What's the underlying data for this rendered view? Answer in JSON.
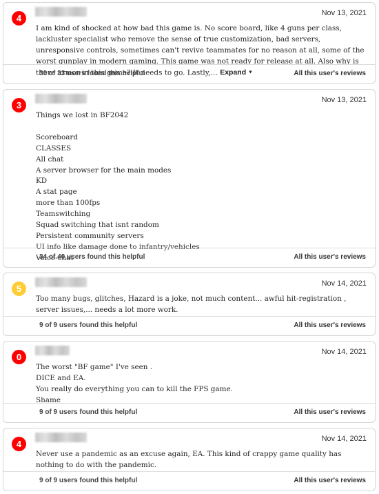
{
  "reviews": [
    {
      "score": "4",
      "score_color": "#ff0000",
      "date": "Nov 13, 2021",
      "text": "I am kind of shocked at how bad this game is. No score board, like 4 guns per class, lackluster specialist who remove the sense of true customization, bad servers, unresponsive controls, sometimes can't revive teammates for no reason at all, some of the worst gunplay in modern gaming. This game was not ready for release at all. Also why is there armor in this game? It needs to go. Lastly,…",
      "expand_label": "Expand",
      "helpful": "30 of 33 users found this helpful",
      "all_reviews_label": "All this user's reviews"
    },
    {
      "score": "3",
      "score_color": "#ff0000",
      "date": "Nov 13, 2021",
      "text": "Things we lost in BF2042\n\nScoreboard\nCLASSES\nAll chat\nA server browser for the main modes\nKD\nA stat page\nmore than 100fps\nTeamswitching\nSquad switching that isnt random\nPersistent community servers\nUI info like damage done to infantry/vehicles\nVoice-chat",
      "helpful": "34 of 40 users found this helpful",
      "all_reviews_label": "All this user's reviews"
    },
    {
      "score": "5",
      "score_color": "#ffcc33",
      "date": "Nov 14, 2021",
      "text": "Too many bugs, glitches, Hazard is a joke, not much content... awful hit-registration , server issues,... needs a lot more work.",
      "helpful": "9 of 9 users found this helpful",
      "all_reviews_label": "All this user's reviews"
    },
    {
      "score": "0",
      "score_color": "#ff0000",
      "date": "Nov 14, 2021",
      "text": "The worst \"BF game\" I've seen .\nDICE and EA.\nYou really do everything you can to kill the FPS game.\nShame",
      "helpful": "9 of 9 users found this helpful",
      "all_reviews_label": "All this user's reviews"
    },
    {
      "score": "4",
      "score_color": "#ff0000",
      "date": "Nov 14, 2021",
      "text": "Never use a pandemic as an excuse again, EA. This kind of crappy game quality has nothing to do with the pandemic.",
      "helpful": "9 of 9 users found this helpful",
      "all_reviews_label": "All this user's reviews"
    }
  ]
}
